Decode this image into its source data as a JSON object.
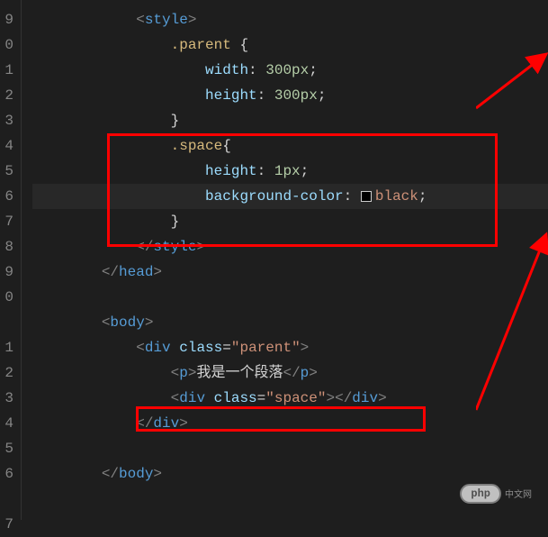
{
  "gutter": [
    "9",
    "0",
    "1",
    "2",
    "3",
    "4",
    "5",
    "6",
    "7",
    "8",
    "9",
    "0",
    "",
    "1",
    "2",
    "3",
    "4",
    "5",
    "6",
    "",
    "7"
  ],
  "code": {
    "l0": {
      "indent": "            ",
      "open": "<",
      "tag": "style",
      "close": ">"
    },
    "l1": {
      "indent": "                ",
      "sel": ".parent ",
      "brace": "{"
    },
    "l2": {
      "indent": "                    ",
      "prop": "width",
      "colon": ": ",
      "val": "300px",
      "semi": ";"
    },
    "l3": {
      "indent": "                    ",
      "prop": "height",
      "colon": ": ",
      "val": "300px",
      "semi": ";"
    },
    "l4": {
      "indent": "                ",
      "brace": "}"
    },
    "l5": {
      "indent": "                ",
      "sel": ".space",
      "brace": "{"
    },
    "l6": {
      "indent": "                    ",
      "prop": "height",
      "colon": ": ",
      "val": "1px",
      "semi": ";"
    },
    "l7": {
      "indent": "                    ",
      "prop": "background-color",
      "colon": ": ",
      "val": "black",
      "semi": ";"
    },
    "l8": {
      "indent": "                ",
      "brace": "}"
    },
    "l9": {
      "indent": "            ",
      "open": "</",
      "tag": "style",
      "close": ">"
    },
    "l10": {
      "indent": "        ",
      "open": "</",
      "tag": "head",
      "close": ">"
    },
    "l11": {
      "text": ""
    },
    "l12": {
      "indent": "        ",
      "open": "<",
      "tag": "body",
      "close": ">"
    },
    "l13": {
      "indent": "            ",
      "open": "<",
      "tag": "div",
      "attr": " class",
      "eq": "=",
      "qval": "\"parent\"",
      "close": ">"
    },
    "l14": {
      "indent": "                ",
      "open": "<",
      "tag": "p",
      "close": ">",
      "text": "我是一个段落",
      "open2": "</",
      "tag2": "p",
      "close2": ">"
    },
    "l15": {
      "indent": "                ",
      "open": "<",
      "tag": "div",
      "attr": " class",
      "eq": "=",
      "qval": "\"space\"",
      "close": ">",
      "open2": "</",
      "tag2": "div",
      "close2": ">"
    },
    "l16": {
      "indent": "            ",
      "open": "</",
      "tag": "div",
      "close": ">"
    },
    "l17": {
      "text": ""
    },
    "l18": {
      "indent": "        ",
      "open": "</",
      "tag": "body",
      "close": ">"
    }
  },
  "watermark": {
    "badge": "php",
    "text": "中文网"
  }
}
